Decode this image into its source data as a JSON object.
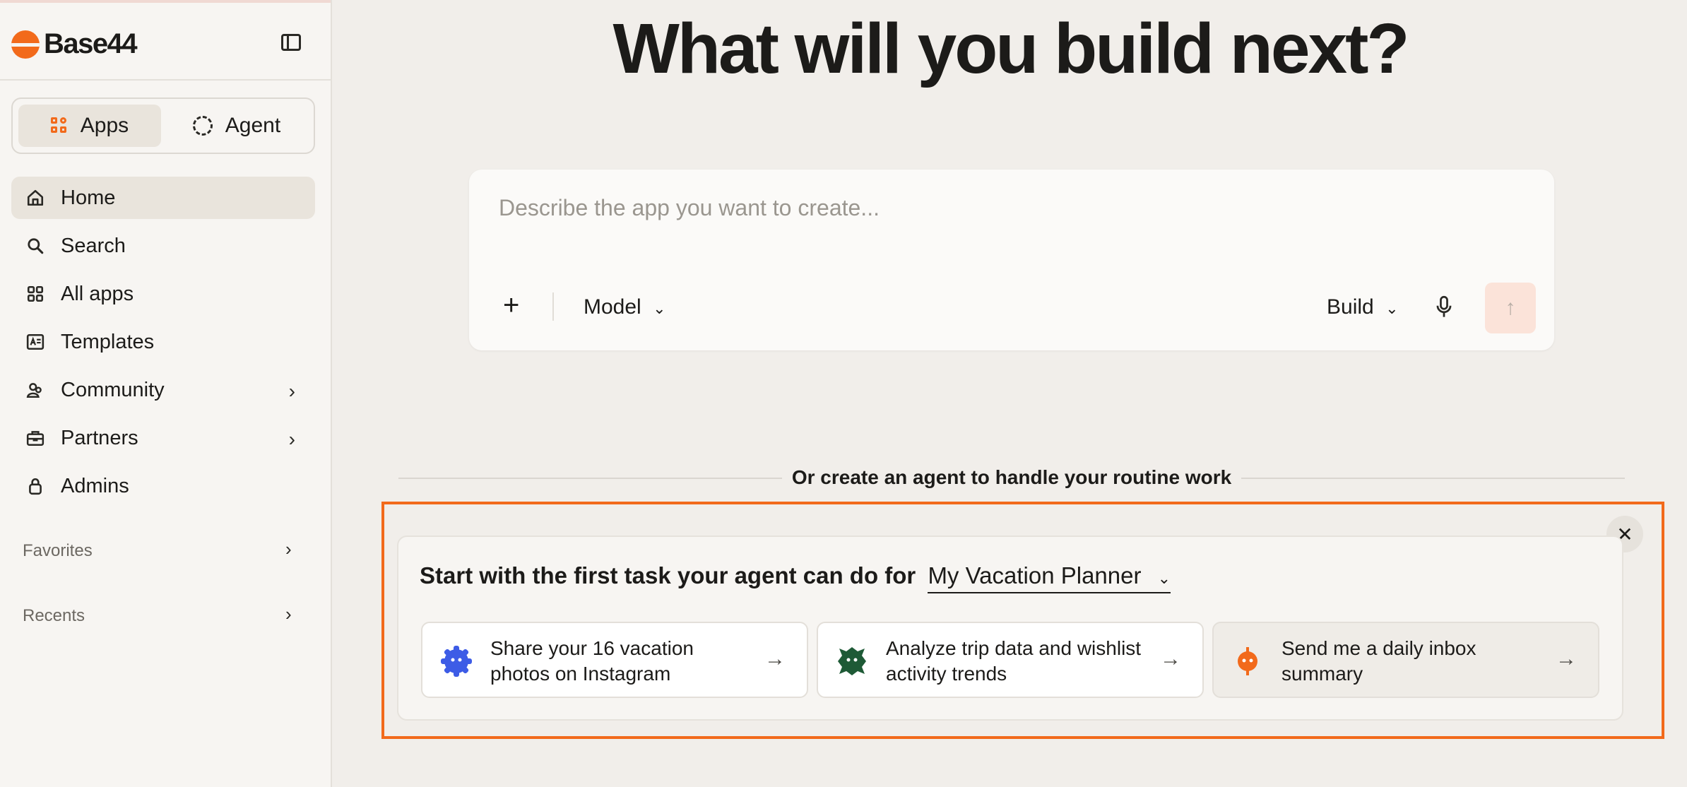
{
  "brand": {
    "name": "Base44",
    "color": "#f26a1b"
  },
  "sidebar": {
    "mode_tabs": [
      {
        "label": "Apps",
        "icon": "apps-icon",
        "active": true
      },
      {
        "label": "Agent",
        "icon": "agent-icon",
        "active": false
      }
    ],
    "items": [
      {
        "label": "Home",
        "icon": "home-icon",
        "active": true
      },
      {
        "label": "Search",
        "icon": "search-icon"
      },
      {
        "label": "All apps",
        "icon": "grid-icon"
      },
      {
        "label": "Templates",
        "icon": "templates-icon"
      },
      {
        "label": "Community",
        "icon": "community-icon",
        "has_chevron": true
      },
      {
        "label": "Partners",
        "icon": "briefcase-icon",
        "has_chevron": true
      },
      {
        "label": "Admins",
        "icon": "lock-icon"
      }
    ],
    "sections": {
      "favorites": "Favorites",
      "recents": "Recents"
    }
  },
  "main": {
    "headline": "What will you build next?",
    "prompt": {
      "placeholder": "Describe the app you want to create...",
      "model_label": "Model",
      "build_label": "Build"
    },
    "divider_text": "Or create an agent to handle your routine work",
    "agent_card": {
      "title": "Start with the first task your agent can do for",
      "app_selector": "My Vacation Planner",
      "tasks": [
        {
          "text": "Share your 16 vacation photos on Instagram",
          "icon": "blue-gear-icon",
          "color": "#3d5ce6"
        },
        {
          "text": "Analyze trip data and wishlist activity trends",
          "icon": "green-badge-icon",
          "color": "#1e5a36"
        },
        {
          "text": "Send me a daily inbox summary",
          "icon": "orange-bot-icon",
          "color": "#f26a1b"
        }
      ]
    }
  }
}
